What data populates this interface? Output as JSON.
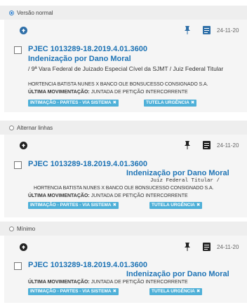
{
  "options": [
    {
      "label": "Versão normal",
      "checked": true
    },
    {
      "label": "Alternar linhas",
      "checked": false
    },
    {
      "label": "Mínimo",
      "checked": false
    }
  ],
  "icons": {
    "upload": "arrow-up-circle-icon",
    "pin": "pin-icon",
    "document": "document-icon"
  },
  "colors": {
    "link": "#1d73b5",
    "tag": "#4fb0d8",
    "option_bg": "#eeeeee",
    "card_bg": "#f5f5f5"
  },
  "process": {
    "date": "24-11-20",
    "number": "PJEC 1013289-18.2019.4.01.3600",
    "class": "Indenização por Dano Moral",
    "court_normal": "/ 9ª Vara Federal de Juizado Especial Cível da SJMT / Juiz Federal Titular",
    "court_alt": "Juiz Federal Titular /",
    "parties": "HORTENCIA BATISTA NUNES X BANCO OLE BONSUCESSO CONSIGNADO S.A.",
    "movement_label": "ÚLTIMA MOVIMENTAÇÃO:",
    "movement_value": "JUNTADA DE PETIÇÃO INTERCORRENTE",
    "tags": [
      "INTIMAÇÃO - PARTES - VIA SISTEMA",
      "TUTELA URGÊNCIA"
    ],
    "tag_close": "✖"
  }
}
